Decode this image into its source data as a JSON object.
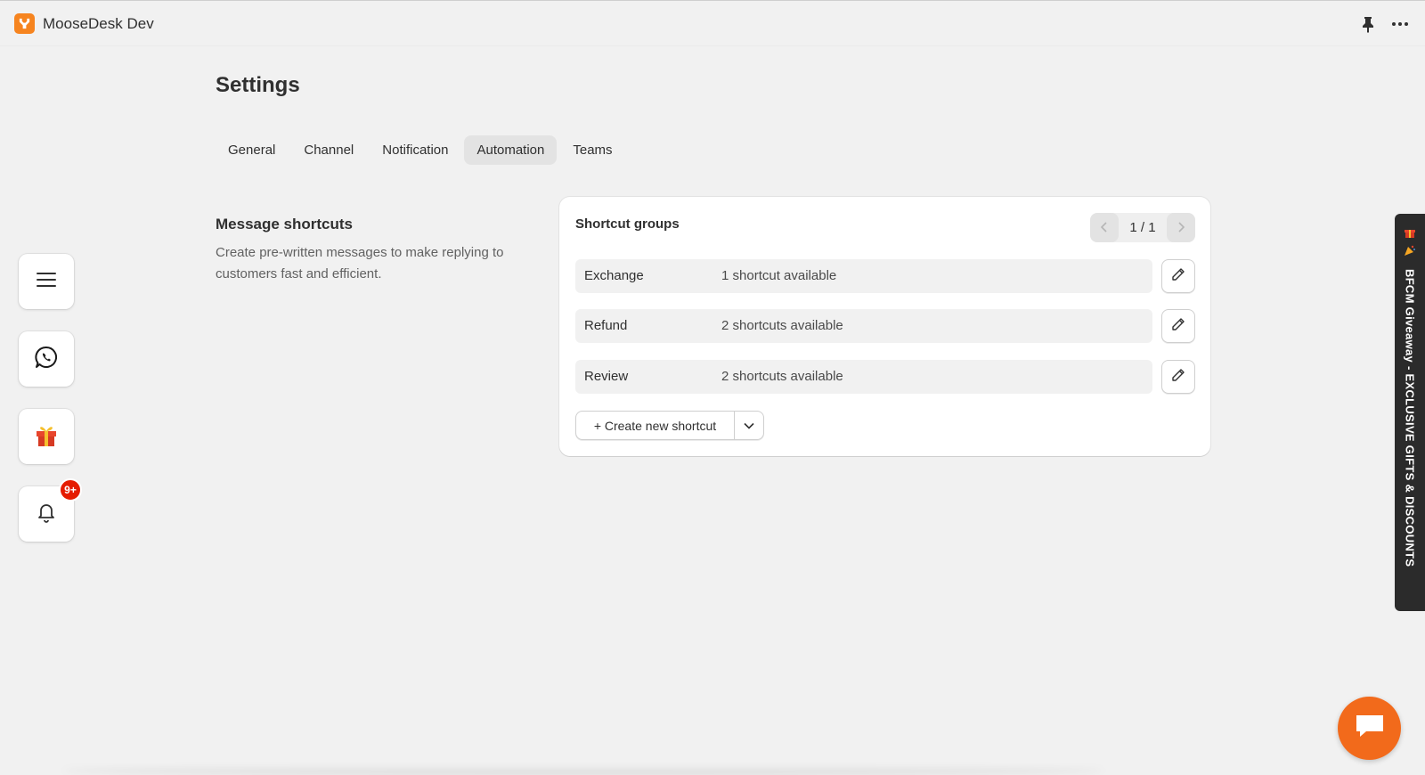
{
  "app": {
    "title": "MooseDesk Dev"
  },
  "page": {
    "title": "Settings"
  },
  "tabs": [
    {
      "label": "General",
      "active": false
    },
    {
      "label": "Channel",
      "active": false
    },
    {
      "label": "Notification",
      "active": false
    },
    {
      "label": "Automation",
      "active": true
    },
    {
      "label": "Teams",
      "active": false
    }
  ],
  "section": {
    "title": "Message shortcuts",
    "description": "Create pre-written messages to make replying to customers fast and efficient."
  },
  "card": {
    "title": "Shortcut groups",
    "pager": "1 / 1",
    "groups": [
      {
        "name": "Exchange",
        "count": "1 shortcut available"
      },
      {
        "name": "Refund",
        "count": "2 shortcuts available"
      },
      {
        "name": "Review",
        "count": "2 shortcuts available"
      }
    ],
    "create_label": "+ Create new shortcut"
  },
  "sidebar": {
    "icons": [
      "menu-icon",
      "whatsapp-icon",
      "gift-icon",
      "bell-icon"
    ],
    "notification_badge": "9+"
  },
  "promo": {
    "text": "BFCM Giveaway - EXCLUSIVE GIFTS & DISCOUNTS"
  },
  "colors": {
    "accent": "#f26a1b",
    "badge": "#e51c00",
    "logo": "#f6841f"
  }
}
